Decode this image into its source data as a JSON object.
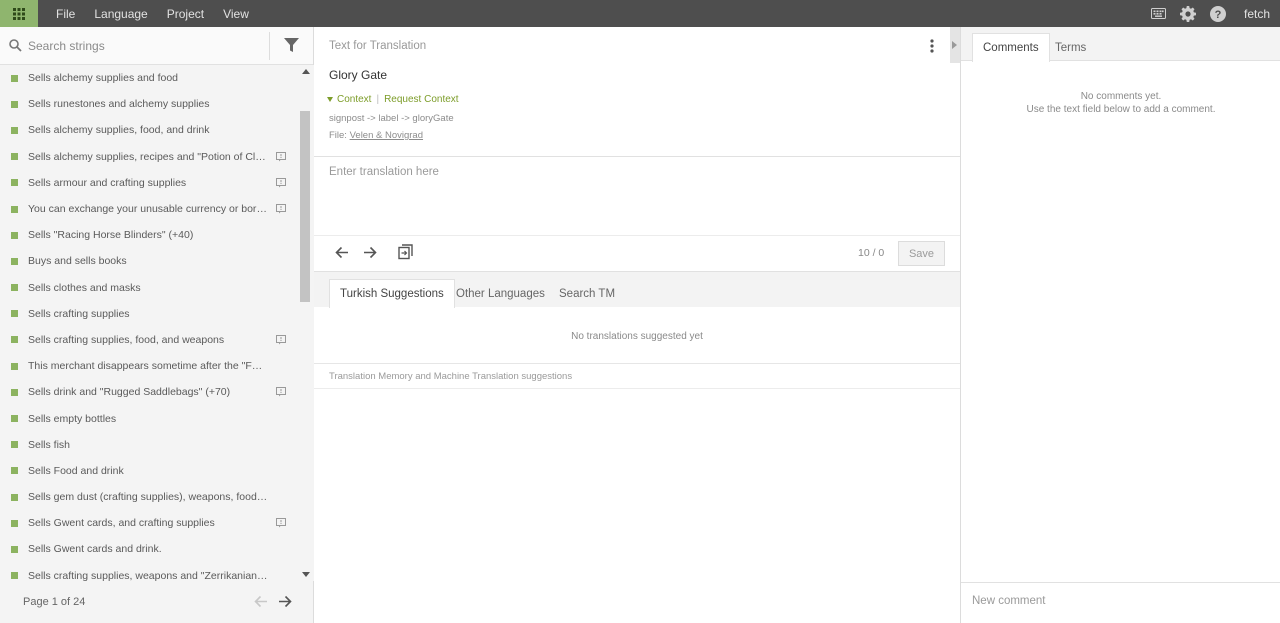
{
  "topbar": {
    "menu": [
      "File",
      "Language",
      "Project",
      "View"
    ],
    "user": "fetch"
  },
  "left": {
    "search_placeholder": "Search strings",
    "items": [
      {
        "text": "Sells alchemy supplies and food",
        "comment": false
      },
      {
        "text": "Sells runestones and alchemy supplies",
        "comment": false
      },
      {
        "text": "Sells alchemy supplies, food, and drink",
        "comment": false
      },
      {
        "text": "Sells alchemy supplies, recipes and \"Potion of Clear...",
        "comment": true
      },
      {
        "text": "Sells armour and crafting supplies",
        "comment": true
      },
      {
        "text": "You can exchange your unusable currency or borro...",
        "comment": true
      },
      {
        "text": "Sells \"Racing Horse Blinders\" (+40)",
        "comment": false
      },
      {
        "text": "Buys and sells books",
        "comment": false
      },
      {
        "text": "Sells clothes and masks",
        "comment": false
      },
      {
        "text": "Sells crafting supplies",
        "comment": false
      },
      {
        "text": "Sells crafting supplies, food, and weapons",
        "comment": true
      },
      {
        "text": "This merchant disappears sometime after the \"Family ...",
        "comment": false
      },
      {
        "text": "Sells drink and \"Rugged Saddlebags\" (+70)",
        "comment": true
      },
      {
        "text": "Sells empty bottles",
        "comment": false
      },
      {
        "text": "Sells fish",
        "comment": false
      },
      {
        "text": "Sells Food and drink",
        "comment": false
      },
      {
        "text": "Sells gem dust (crafting supplies), weapons, food, and d...",
        "comment": false
      },
      {
        "text": "Sells Gwent cards, and crafting supplies",
        "comment": true
      },
      {
        "text": "Sells Gwent cards and drink.",
        "comment": false
      },
      {
        "text": "Sells crafting supplies, weapons and \"Zerrikanian Saddl...",
        "comment": false
      }
    ],
    "pager": "Page 1 of 24"
  },
  "mid": {
    "source_label": "Text for Translation",
    "source_text": "Glory Gate",
    "context_label": "Context",
    "request_context": "Request Context",
    "key_path": "signpost -> label -> gloryGate",
    "file_prefix": "File: ",
    "file_name": "Velen & Novigrad",
    "translation_placeholder": "Enter translation here",
    "counter": "10 / 0",
    "save": "Save",
    "tabs": [
      "Turkish Suggestions",
      "Other Languages",
      "Search TM"
    ],
    "no_suggestions": "No translations suggested yet",
    "tm_label": "Translation Memory and Machine Translation suggestions"
  },
  "right": {
    "tabs": [
      "Comments",
      "Terms"
    ],
    "no_comments_1": "No comments yet.",
    "no_comments_2": "Use the text field below to add a comment.",
    "comment_placeholder": "New comment"
  },
  "colors": {
    "topbar": "#4e4e4e",
    "accent_green": "#8cb360",
    "context_green": "#7d9d2a"
  }
}
